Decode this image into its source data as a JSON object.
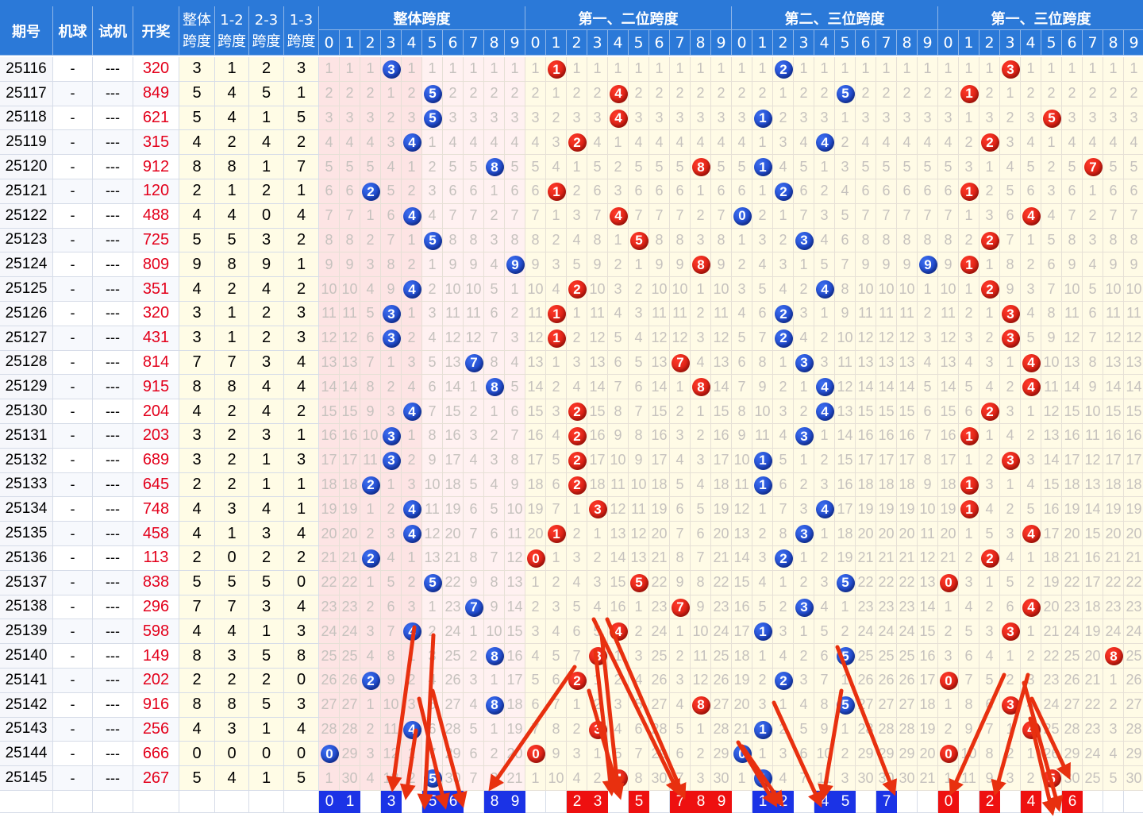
{
  "headers": {
    "issue": "期号",
    "ball": "机球",
    "trial": "试机",
    "open": "开奖",
    "span": "整体\n跨度",
    "s12": "1-2\n跨度",
    "s23": "2-3\n跨度",
    "s13": "1-3\n跨度",
    "groups": [
      "整体跨度",
      "第一、二位跨度",
      "第二、三位跨度",
      "第一、三位跨度"
    ],
    "digits": [
      "0",
      "1",
      "2",
      "3",
      "4",
      "5",
      "6",
      "7",
      "8",
      "9"
    ]
  },
  "colors": {
    "header": "#2b79d8",
    "blue_ball": "#1b33e6",
    "red_ball": "#ee1010",
    "arrow": "#e8300f",
    "open_number": "#e3001b"
  },
  "chart_data": {
    "type": "table",
    "columns": [
      "期号",
      "机球",
      "试机",
      "开奖",
      "整体跨度",
      "1-2跨度",
      "2-3跨度",
      "1-3跨度"
    ],
    "rows": [
      {
        "issue": "25116",
        "ball": "-",
        "trial": "---",
        "open": "320",
        "span": 3,
        "s12": 1,
        "s23": 2,
        "s13": 3
      },
      {
        "issue": "25117",
        "ball": "-",
        "trial": "---",
        "open": "849",
        "span": 5,
        "s12": 4,
        "s23": 5,
        "s13": 1
      },
      {
        "issue": "25118",
        "ball": "-",
        "trial": "---",
        "open": "621",
        "span": 5,
        "s12": 4,
        "s23": 1,
        "s13": 5
      },
      {
        "issue": "25119",
        "ball": "-",
        "trial": "---",
        "open": "315",
        "span": 4,
        "s12": 2,
        "s23": 4,
        "s13": 2
      },
      {
        "issue": "25120",
        "ball": "-",
        "trial": "---",
        "open": "912",
        "span": 8,
        "s12": 8,
        "s23": 1,
        "s13": 7
      },
      {
        "issue": "25121",
        "ball": "-",
        "trial": "---",
        "open": "120",
        "span": 2,
        "s12": 1,
        "s23": 2,
        "s13": 1
      },
      {
        "issue": "25122",
        "ball": "-",
        "trial": "---",
        "open": "488",
        "span": 4,
        "s12": 4,
        "s23": 0,
        "s13": 4
      },
      {
        "issue": "25123",
        "ball": "-",
        "trial": "---",
        "open": "725",
        "span": 5,
        "s12": 5,
        "s23": 3,
        "s13": 2
      },
      {
        "issue": "25124",
        "ball": "-",
        "trial": "---",
        "open": "809",
        "span": 9,
        "s12": 8,
        "s23": 9,
        "s13": 1
      },
      {
        "issue": "25125",
        "ball": "-",
        "trial": "---",
        "open": "351",
        "span": 4,
        "s12": 2,
        "s23": 4,
        "s13": 2
      },
      {
        "issue": "25126",
        "ball": "-",
        "trial": "---",
        "open": "320",
        "span": 3,
        "s12": 1,
        "s23": 2,
        "s13": 3
      },
      {
        "issue": "25127",
        "ball": "-",
        "trial": "---",
        "open": "431",
        "span": 3,
        "s12": 1,
        "s23": 2,
        "s13": 3
      },
      {
        "issue": "25128",
        "ball": "-",
        "trial": "---",
        "open": "814",
        "span": 7,
        "s12": 7,
        "s23": 3,
        "s13": 4
      },
      {
        "issue": "25129",
        "ball": "-",
        "trial": "---",
        "open": "915",
        "span": 8,
        "s12": 8,
        "s23": 4,
        "s13": 4
      },
      {
        "issue": "25130",
        "ball": "-",
        "trial": "---",
        "open": "204",
        "span": 4,
        "s12": 2,
        "s23": 4,
        "s13": 2
      },
      {
        "issue": "25131",
        "ball": "-",
        "trial": "---",
        "open": "203",
        "span": 3,
        "s12": 2,
        "s23": 3,
        "s13": 1
      },
      {
        "issue": "25132",
        "ball": "-",
        "trial": "---",
        "open": "689",
        "span": 3,
        "s12": 2,
        "s23": 1,
        "s13": 3
      },
      {
        "issue": "25133",
        "ball": "-",
        "trial": "---",
        "open": "645",
        "span": 2,
        "s12": 2,
        "s23": 1,
        "s13": 1
      },
      {
        "issue": "25134",
        "ball": "-",
        "trial": "---",
        "open": "748",
        "span": 4,
        "s12": 3,
        "s23": 4,
        "s13": 1
      },
      {
        "issue": "25135",
        "ball": "-",
        "trial": "---",
        "open": "458",
        "span": 4,
        "s12": 1,
        "s23": 3,
        "s13": 4
      },
      {
        "issue": "25136",
        "ball": "-",
        "trial": "---",
        "open": "113",
        "span": 2,
        "s12": 0,
        "s23": 2,
        "s13": 2
      },
      {
        "issue": "25137",
        "ball": "-",
        "trial": "---",
        "open": "838",
        "span": 5,
        "s12": 5,
        "s23": 5,
        "s13": 0
      },
      {
        "issue": "25138",
        "ball": "-",
        "trial": "---",
        "open": "296",
        "span": 7,
        "s12": 7,
        "s23": 3,
        "s13": 4
      },
      {
        "issue": "25139",
        "ball": "-",
        "trial": "---",
        "open": "598",
        "span": 4,
        "s12": 4,
        "s23": 1,
        "s13": 3
      },
      {
        "issue": "25140",
        "ball": "-",
        "trial": "---",
        "open": "149",
        "span": 8,
        "s12": 3,
        "s23": 5,
        "s13": 8
      },
      {
        "issue": "25141",
        "ball": "-",
        "trial": "---",
        "open": "202",
        "span": 2,
        "s12": 2,
        "s23": 2,
        "s13": 0
      },
      {
        "issue": "25142",
        "ball": "-",
        "trial": "---",
        "open": "916",
        "span": 8,
        "s12": 8,
        "s23": 5,
        "s13": 3
      },
      {
        "issue": "25143",
        "ball": "-",
        "trial": "---",
        "open": "256",
        "span": 4,
        "s12": 3,
        "s23": 1,
        "s13": 4
      },
      {
        "issue": "25144",
        "ball": "-",
        "trial": "---",
        "open": "666",
        "span": 0,
        "s12": 0,
        "s23": 0,
        "s13": 0
      },
      {
        "issue": "25145",
        "ball": "-",
        "trial": "---",
        "open": "267",
        "span": 5,
        "s12": 4,
        "s23": 1,
        "s13": 5
      }
    ],
    "predictions": {
      "整体跨度": [
        "0",
        "1",
        "3",
        "5",
        "6",
        "8",
        "9"
      ],
      "第一、二位跨度": [
        "2",
        "3",
        "5",
        "7",
        "8",
        "9"
      ],
      "第二、三位跨度": [
        "1",
        "2",
        "4",
        "5",
        "7"
      ],
      "第一、三位跨度": [
        "0",
        "2",
        "4",
        "6"
      ]
    },
    "arrows_drawn": 21
  }
}
